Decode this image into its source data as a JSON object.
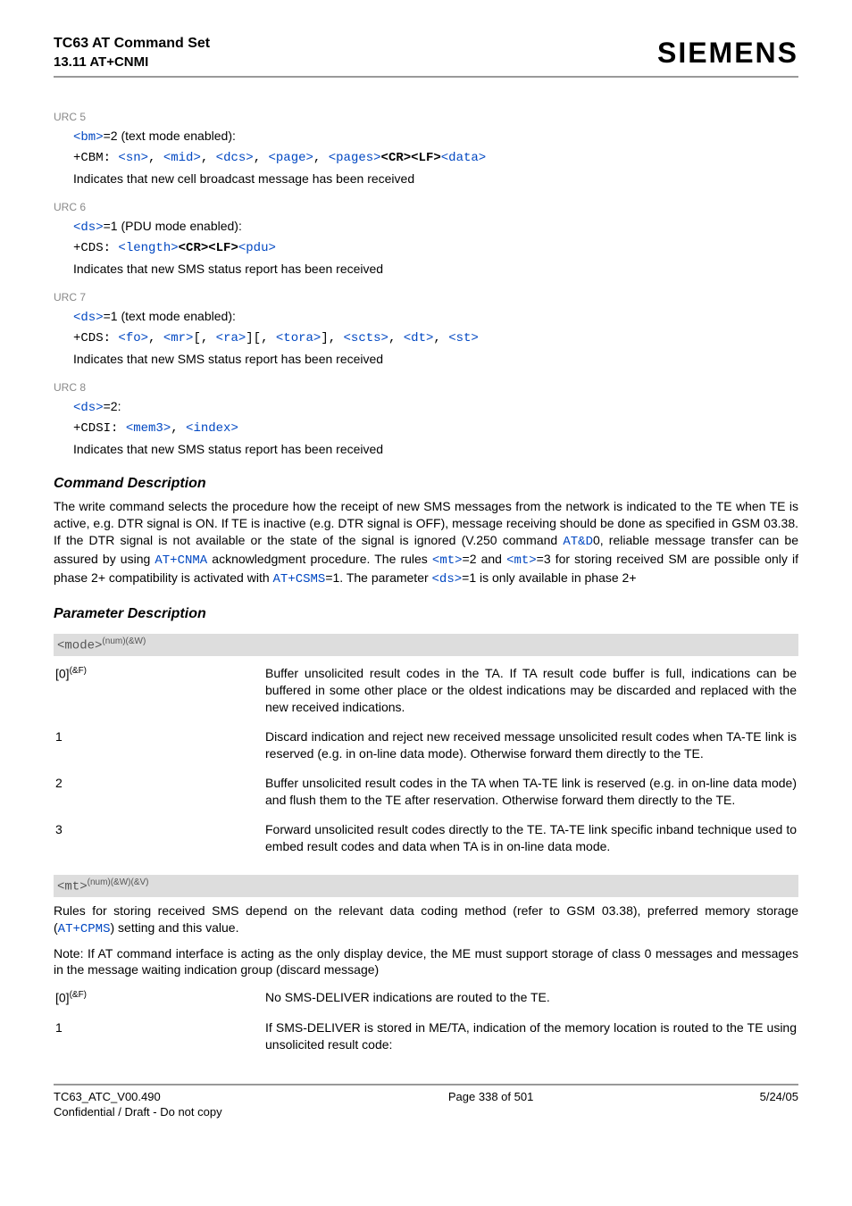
{
  "header": {
    "title": "TC63 AT Command Set",
    "section": "13.11 AT+CNMI",
    "brand": "SIEMENS"
  },
  "urc5": {
    "label": "URC 5",
    "line1_pre": "<bm>",
    "line1_post": "=2 (text mode enabled):",
    "code_prefix": "+CBM: ",
    "p1": "<sn>",
    "c1": ", ",
    "p2": "<mid>",
    "c2": ", ",
    "p3": "<dcs>",
    "c3": ", ",
    "p4": "<page>",
    "c4": ", ",
    "p5": "<pages>",
    "crlf": "<CR><LF>",
    "p6": "<data>",
    "desc": "Indicates that new cell broadcast message has been received"
  },
  "urc6": {
    "label": "URC 6",
    "line1_pre": "<ds>",
    "line1_post": "=1 (PDU mode enabled):",
    "code_prefix": "+CDS: ",
    "p1": "<length>",
    "crlf": "<CR><LF>",
    "p2": "<pdu>",
    "desc": "Indicates that new SMS status report has been received"
  },
  "urc7": {
    "label": "URC 7",
    "line1_pre": "<ds>",
    "line1_post": "=1 (text mode enabled):",
    "code_prefix": "+CDS: ",
    "p1": "<fo>",
    "c1": ", ",
    "p2": "<mr>",
    "c2": "[, ",
    "p3": "<ra>",
    "c3": "][, ",
    "p4": "<tora>",
    "c4": "], ",
    "p5": "<scts>",
    "c5": ", ",
    "p6": "<dt>",
    "c6": ", ",
    "p7": "<st>",
    "desc": "Indicates that new SMS status report has been received"
  },
  "urc8": {
    "label": "URC 8",
    "line1_pre": "<ds>",
    "line1_post": "=2:",
    "code_prefix": "+CDSI: ",
    "p1": "<mem3>",
    "c1": ", ",
    "p2": "<index>",
    "desc": "Indicates that new SMS status report has been received"
  },
  "cmd_desc": {
    "heading": "Command Description",
    "t1": "The write command selects the procedure how the receipt of new SMS messages from the network is indicated to the TE when TE is active, e.g. DTR signal is ON. If TE is inactive (e.g. DTR signal is OFF), message receiving should be done as specified in GSM 03.38. If the DTR signal is not available or the state of the signal is ignored (V.250 command ",
    "l1": "AT&D",
    "t2": "0, reliable message transfer can be assured by using ",
    "l2": "AT+CNMA",
    "t3": " acknowledgment procedure. The rules ",
    "l3": "<mt>",
    "t4": "=2 and ",
    "l4": "<mt>",
    "t5": "=3 for storing received SM are possible only if phase 2+ compatibility is activated with ",
    "l5": "AT+CSMS",
    "t6": "=1. The parameter ",
    "l6": "<ds>",
    "t7": "=1 is only available in phase 2+"
  },
  "param_desc": {
    "heading": "Parameter Description",
    "mode_tag": "<mode>",
    "mode_sup": "(num)(&W)",
    "rows": [
      {
        "k_pre": "[0]",
        "k_sup": "(&F)",
        "v": "Buffer unsolicited result codes in the TA. If TA result code buffer is full, indications can be buffered in some other place or the oldest indications may be discarded and replaced with the new received indications."
      },
      {
        "k": "1",
        "v": "Discard indication and reject new received message unsolicited result codes when TA-TE link is reserved (e.g. in on-line data mode). Otherwise forward them directly to the TE."
      },
      {
        "k": "2",
        "v": "Buffer unsolicited result codes in the TA when TA-TE link is reserved (e.g. in on-line data mode) and flush them to the TE after reservation. Otherwise forward them directly to the TE."
      },
      {
        "k": "3",
        "v": "Forward unsolicited result codes directly to the TE. TA-TE link specific inband technique used to embed result codes and data when TA is in on-line data mode."
      }
    ],
    "mt_tag": "<mt>",
    "mt_sup": "(num)(&W)(&V)",
    "mt_p1": "Rules for storing received SMS depend on the relevant data coding method (refer to GSM 03.38), preferred memory storage (",
    "mt_l1": "AT+CPMS",
    "mt_p2": ") setting and this value.",
    "mt_note": "Note: If AT command interface is acting as the only display device, the ME must support storage of class 0 messages and messages in the message waiting indication group (discard message)",
    "mt_rows": [
      {
        "k_pre": "[0]",
        "k_sup": "(&F)",
        "v": "No SMS-DELIVER indications are routed to the TE."
      },
      {
        "k": "1",
        "v": "If SMS-DELIVER is stored in ME/TA, indication of the memory location is routed to the TE using unsolicited result code:"
      }
    ]
  },
  "footer": {
    "left1": "TC63_ATC_V00.490",
    "left2": "Confidential / Draft - Do not copy",
    "center": "Page 338 of 501",
    "right": "5/24/05"
  }
}
